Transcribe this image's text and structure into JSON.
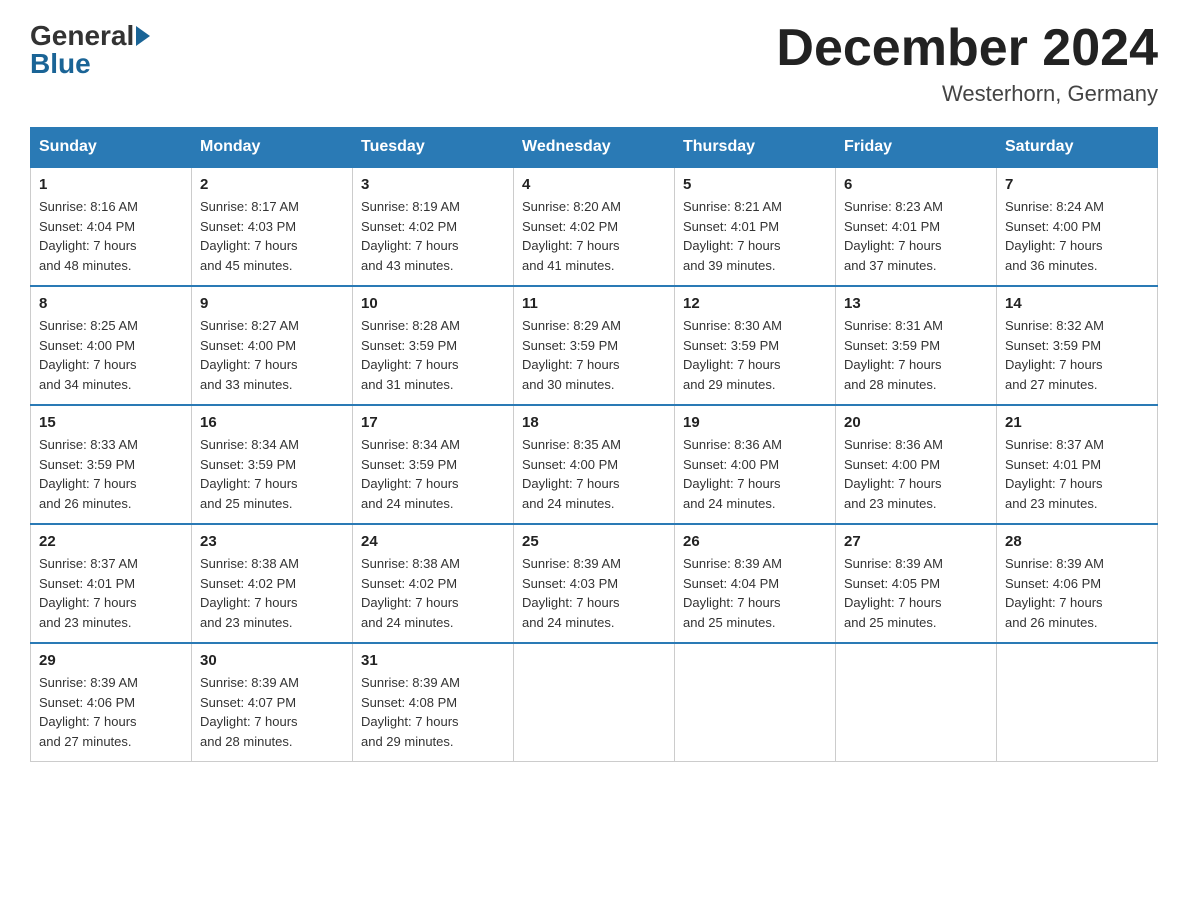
{
  "header": {
    "logo_general": "General",
    "logo_blue": "Blue",
    "month_title": "December 2024",
    "location": "Westerhorn, Germany"
  },
  "days_of_week": [
    "Sunday",
    "Monday",
    "Tuesday",
    "Wednesday",
    "Thursday",
    "Friday",
    "Saturday"
  ],
  "weeks": [
    [
      {
        "day": "1",
        "info": "Sunrise: 8:16 AM\nSunset: 4:04 PM\nDaylight: 7 hours\nand 48 minutes."
      },
      {
        "day": "2",
        "info": "Sunrise: 8:17 AM\nSunset: 4:03 PM\nDaylight: 7 hours\nand 45 minutes."
      },
      {
        "day": "3",
        "info": "Sunrise: 8:19 AM\nSunset: 4:02 PM\nDaylight: 7 hours\nand 43 minutes."
      },
      {
        "day": "4",
        "info": "Sunrise: 8:20 AM\nSunset: 4:02 PM\nDaylight: 7 hours\nand 41 minutes."
      },
      {
        "day": "5",
        "info": "Sunrise: 8:21 AM\nSunset: 4:01 PM\nDaylight: 7 hours\nand 39 minutes."
      },
      {
        "day": "6",
        "info": "Sunrise: 8:23 AM\nSunset: 4:01 PM\nDaylight: 7 hours\nand 37 minutes."
      },
      {
        "day": "7",
        "info": "Sunrise: 8:24 AM\nSunset: 4:00 PM\nDaylight: 7 hours\nand 36 minutes."
      }
    ],
    [
      {
        "day": "8",
        "info": "Sunrise: 8:25 AM\nSunset: 4:00 PM\nDaylight: 7 hours\nand 34 minutes."
      },
      {
        "day": "9",
        "info": "Sunrise: 8:27 AM\nSunset: 4:00 PM\nDaylight: 7 hours\nand 33 minutes."
      },
      {
        "day": "10",
        "info": "Sunrise: 8:28 AM\nSunset: 3:59 PM\nDaylight: 7 hours\nand 31 minutes."
      },
      {
        "day": "11",
        "info": "Sunrise: 8:29 AM\nSunset: 3:59 PM\nDaylight: 7 hours\nand 30 minutes."
      },
      {
        "day": "12",
        "info": "Sunrise: 8:30 AM\nSunset: 3:59 PM\nDaylight: 7 hours\nand 29 minutes."
      },
      {
        "day": "13",
        "info": "Sunrise: 8:31 AM\nSunset: 3:59 PM\nDaylight: 7 hours\nand 28 minutes."
      },
      {
        "day": "14",
        "info": "Sunrise: 8:32 AM\nSunset: 3:59 PM\nDaylight: 7 hours\nand 27 minutes."
      }
    ],
    [
      {
        "day": "15",
        "info": "Sunrise: 8:33 AM\nSunset: 3:59 PM\nDaylight: 7 hours\nand 26 minutes."
      },
      {
        "day": "16",
        "info": "Sunrise: 8:34 AM\nSunset: 3:59 PM\nDaylight: 7 hours\nand 25 minutes."
      },
      {
        "day": "17",
        "info": "Sunrise: 8:34 AM\nSunset: 3:59 PM\nDaylight: 7 hours\nand 24 minutes."
      },
      {
        "day": "18",
        "info": "Sunrise: 8:35 AM\nSunset: 4:00 PM\nDaylight: 7 hours\nand 24 minutes."
      },
      {
        "day": "19",
        "info": "Sunrise: 8:36 AM\nSunset: 4:00 PM\nDaylight: 7 hours\nand 24 minutes."
      },
      {
        "day": "20",
        "info": "Sunrise: 8:36 AM\nSunset: 4:00 PM\nDaylight: 7 hours\nand 23 minutes."
      },
      {
        "day": "21",
        "info": "Sunrise: 8:37 AM\nSunset: 4:01 PM\nDaylight: 7 hours\nand 23 minutes."
      }
    ],
    [
      {
        "day": "22",
        "info": "Sunrise: 8:37 AM\nSunset: 4:01 PM\nDaylight: 7 hours\nand 23 minutes."
      },
      {
        "day": "23",
        "info": "Sunrise: 8:38 AM\nSunset: 4:02 PM\nDaylight: 7 hours\nand 23 minutes."
      },
      {
        "day": "24",
        "info": "Sunrise: 8:38 AM\nSunset: 4:02 PM\nDaylight: 7 hours\nand 24 minutes."
      },
      {
        "day": "25",
        "info": "Sunrise: 8:39 AM\nSunset: 4:03 PM\nDaylight: 7 hours\nand 24 minutes."
      },
      {
        "day": "26",
        "info": "Sunrise: 8:39 AM\nSunset: 4:04 PM\nDaylight: 7 hours\nand 25 minutes."
      },
      {
        "day": "27",
        "info": "Sunrise: 8:39 AM\nSunset: 4:05 PM\nDaylight: 7 hours\nand 25 minutes."
      },
      {
        "day": "28",
        "info": "Sunrise: 8:39 AM\nSunset: 4:06 PM\nDaylight: 7 hours\nand 26 minutes."
      }
    ],
    [
      {
        "day": "29",
        "info": "Sunrise: 8:39 AM\nSunset: 4:06 PM\nDaylight: 7 hours\nand 27 minutes."
      },
      {
        "day": "30",
        "info": "Sunrise: 8:39 AM\nSunset: 4:07 PM\nDaylight: 7 hours\nand 28 minutes."
      },
      {
        "day": "31",
        "info": "Sunrise: 8:39 AM\nSunset: 4:08 PM\nDaylight: 7 hours\nand 29 minutes."
      },
      {
        "day": "",
        "info": ""
      },
      {
        "day": "",
        "info": ""
      },
      {
        "day": "",
        "info": ""
      },
      {
        "day": "",
        "info": ""
      }
    ]
  ]
}
